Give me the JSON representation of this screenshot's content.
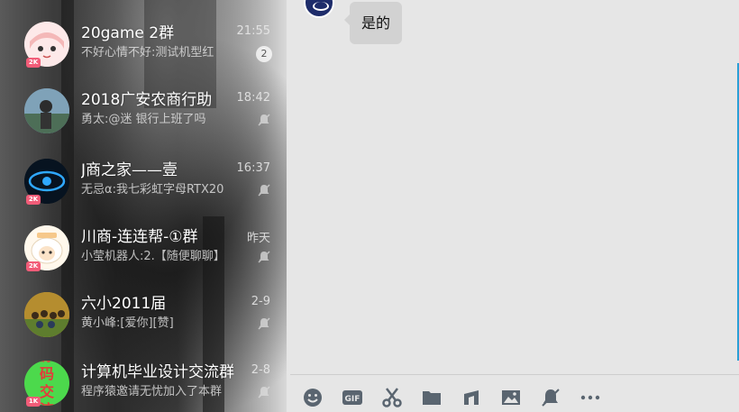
{
  "conversations": [
    {
      "title": "20game 2群",
      "message": "不好心情不好:测试机型红",
      "time": "21:55",
      "unread": "2",
      "level": "2K",
      "avatar": "anime-girl-avatar"
    },
    {
      "title": "2018广安农商行助",
      "message": "勇太:@迷 银行上班了吗",
      "time": "18:42",
      "unread": null,
      "level": null,
      "avatar": "photo-avatar"
    },
    {
      "title": "J商之家——壹",
      "message": "无忌α:我七彩虹字母RTX20",
      "time": "16:37",
      "unread": null,
      "level": "2K",
      "avatar": "eye-logo-avatar"
    },
    {
      "title": "川商-连连帮-①群",
      "message": "小莹机器人:2.【随便聊聊】",
      "time": "昨天",
      "unread": null,
      "level": "2K",
      "avatar": "sheep-avatar"
    },
    {
      "title": "六小2011届",
      "message": "黄小峰:[爱你][赞]",
      "time": "2-9",
      "unread": null,
      "level": null,
      "avatar": "group-photo-avatar"
    },
    {
      "title": "计算机毕业设计交流群",
      "message": "程序猿邀请无忧加入了本群",
      "time": "2-8",
      "unread": null,
      "level": "1K",
      "avatar": "source-code-avatar",
      "avatar_text": "源码交流"
    }
  ],
  "chat": {
    "bubble_text": "是的"
  },
  "toolbar": [
    "emoji-icon",
    "gif-icon",
    "scissors-icon",
    "folder-icon",
    "music-icon",
    "image-icon",
    "mute-bell-icon",
    "more-icon"
  ],
  "colors": {
    "accent": "#2a9fd6",
    "level_badge": "#f25c78"
  }
}
